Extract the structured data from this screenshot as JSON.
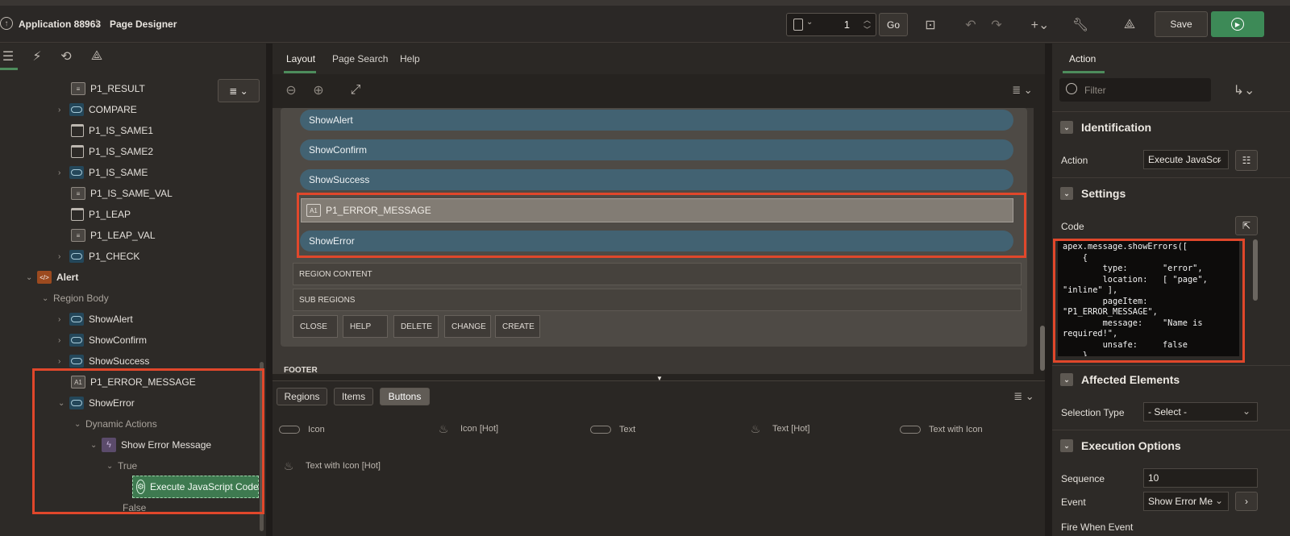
{
  "header": {
    "app_label": "Application 88963",
    "separator": "\\",
    "page_title": "Page Designer",
    "page_number": "1",
    "go_label": "Go",
    "save_label": "Save"
  },
  "left_tree": {
    "items": [
      {
        "label": "P1_RESULT"
      },
      {
        "label": "COMPARE"
      },
      {
        "label": "P1_IS_SAME1"
      },
      {
        "label": "P1_IS_SAME2"
      },
      {
        "label": "P1_IS_SAME"
      },
      {
        "label": "P1_IS_SAME_VAL"
      },
      {
        "label": "P1_LEAP"
      },
      {
        "label": "P1_LEAP_VAL"
      },
      {
        "label": "P1_CHECK"
      },
      {
        "label": "Alert"
      },
      {
        "label": "Region Body"
      },
      {
        "label": "ShowAlert"
      },
      {
        "label": "ShowConfirm"
      },
      {
        "label": "ShowSuccess"
      },
      {
        "label": "P1_ERROR_MESSAGE"
      },
      {
        "label": "ShowError"
      },
      {
        "label": "Dynamic Actions"
      },
      {
        "label": "Show Error Message"
      },
      {
        "label": "True"
      },
      {
        "label": "Execute JavaScript Code"
      },
      {
        "label": "False"
      }
    ]
  },
  "middle": {
    "tabs": [
      {
        "label": "Layout"
      },
      {
        "label": "Page Search"
      },
      {
        "label": "Help"
      }
    ],
    "canvas": {
      "pills": [
        "ShowAlert",
        "ShowConfirm",
        "ShowSuccess"
      ],
      "error_item": "P1_ERROR_MESSAGE",
      "error_item_icon": "A1",
      "show_error": "ShowError",
      "region_content": "REGION CONTENT",
      "sub_regions": "SUB REGIONS",
      "slot_buttons": [
        "CLOSE",
        "HELP",
        "DELETE",
        "CHANGE",
        "CREATE"
      ],
      "footer": "FOOTER"
    },
    "gallery": {
      "tabs": [
        "Regions",
        "Items",
        "Buttons"
      ],
      "active_tab": "Buttons",
      "items": [
        "Icon",
        "Icon [Hot]",
        "Text",
        "Text [Hot]",
        "Text with Icon",
        "Text with Icon [Hot]"
      ]
    }
  },
  "right": {
    "tab": "Action",
    "filter_placeholder": "Filter",
    "sections": {
      "identification": "Identification",
      "settings": "Settings",
      "affected": "Affected Elements",
      "execution": "Execution Options"
    },
    "action_label": "Action",
    "action_value": "Execute JavaScr",
    "code_label": "Code",
    "code": "apex.message.showErrors([\n    {\n        type:       \"error\",\n        location:   [ \"page\",\n\"inline\" ],\n        pageItem:\n\"P1_ERROR_MESSAGE\",\n        message:    \"Name is\nrequired!\",\n        unsafe:     false\n    },",
    "selection_type_label": "Selection Type",
    "selection_type_value": "- Select -",
    "sequence_label": "Sequence",
    "sequence_value": "10",
    "event_label": "Event",
    "event_value": "Show Error Me",
    "fire_label": "Fire When Event"
  },
  "colors": {
    "accent_green": "#4d8c5c",
    "highlight_red": "#e0472b",
    "pill_blue": "#426272"
  }
}
